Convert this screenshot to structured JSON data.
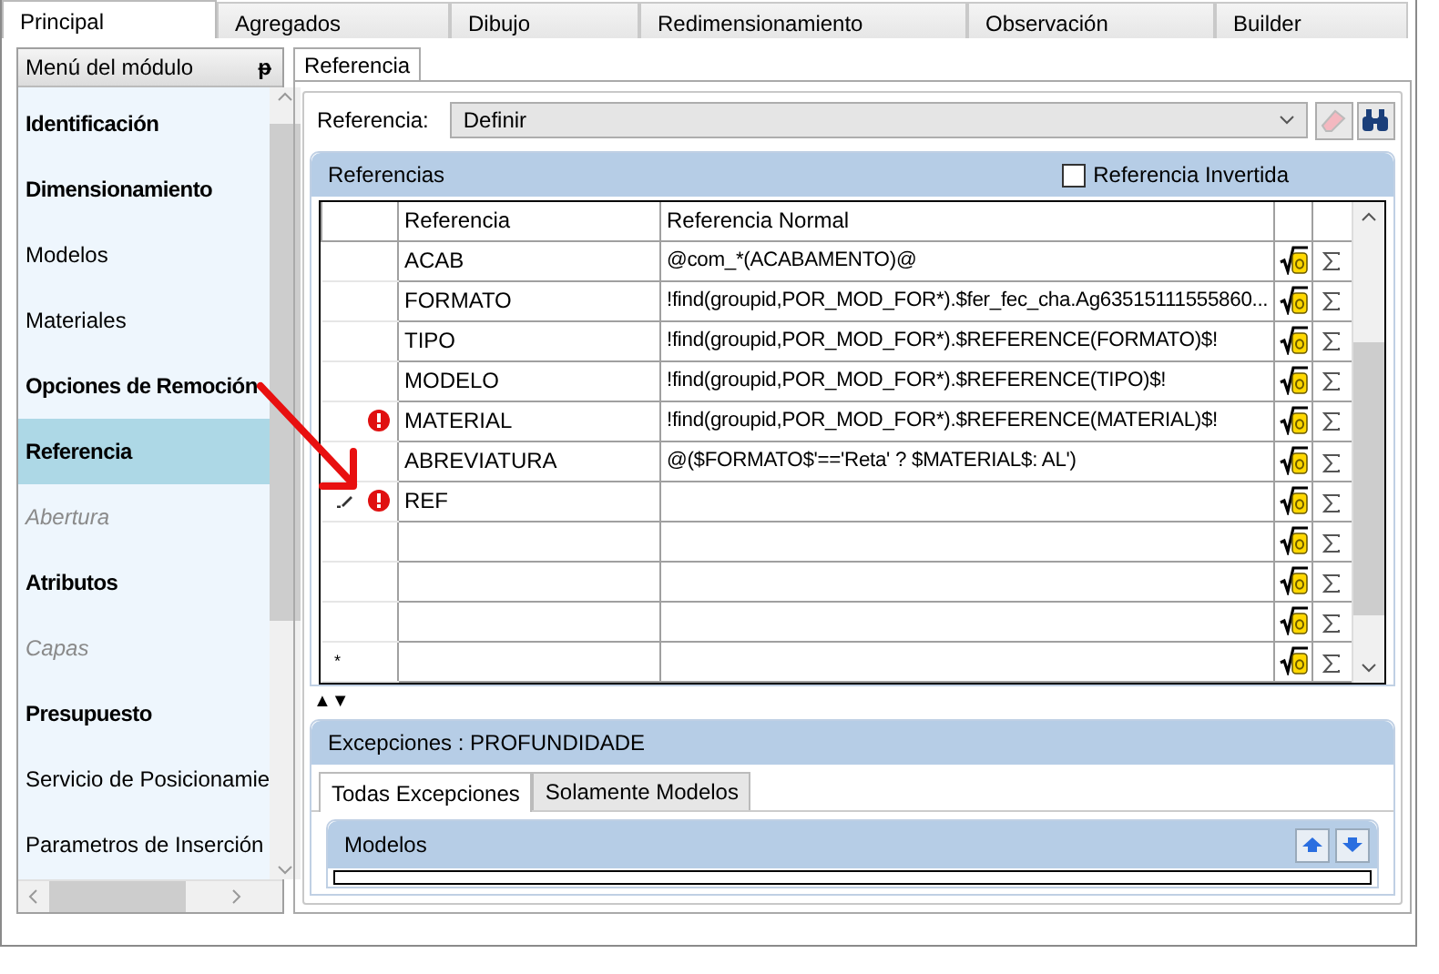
{
  "tabs": [
    {
      "label": "Principal",
      "selected": true
    },
    {
      "label": "Agregados",
      "selected": false
    },
    {
      "label": "Dibujo",
      "selected": false
    },
    {
      "label": "Redimensionamiento",
      "selected": false
    },
    {
      "label": "Observación",
      "selected": false
    },
    {
      "label": "Builder",
      "selected": false
    }
  ],
  "sidebar": {
    "title": "Menú del módulo",
    "pin": "ᵽ",
    "items": [
      {
        "label": "Identificación",
        "kind": "bold",
        "selected": false
      },
      {
        "label": "Dimensionamiento",
        "kind": "bold",
        "selected": false
      },
      {
        "label": "Modelos",
        "kind": "normal",
        "selected": false
      },
      {
        "label": "Materiales",
        "kind": "normal",
        "selected": false
      },
      {
        "label": "Opciones de Remoción",
        "kind": "bold",
        "selected": false
      },
      {
        "label": "Referencia",
        "kind": "bold",
        "selected": true
      },
      {
        "label": "Abertura",
        "kind": "disabled",
        "selected": false
      },
      {
        "label": "Atributos",
        "kind": "bold",
        "selected": false
      },
      {
        "label": "Capas",
        "kind": "disabled",
        "selected": false
      },
      {
        "label": "Presupuesto",
        "kind": "bold",
        "selected": false
      },
      {
        "label": "Servicio de Posicionamie",
        "kind": "normal",
        "selected": false
      },
      {
        "label": "Parametros de Inserción",
        "kind": "normal",
        "selected": false
      }
    ]
  },
  "content_tab": {
    "label": "Referencia",
    "selected": true
  },
  "reference_field": {
    "label": "Referencia:",
    "value": "Definir"
  },
  "references": {
    "title": "Referencias",
    "inverted": {
      "label": "Referencia Invertida",
      "checked": false
    },
    "columns": [
      "Referencia",
      "Referencia Normal"
    ],
    "rows": [
      {
        "reference": "ACAB",
        "normal": "@com_*(ACABAMENTO)@",
        "error": false,
        "editing": false
      },
      {
        "reference": "FORMATO",
        "normal": "!find(groupid,POR_MOD_FOR*).$fer_fec_cha.Ag63515111555860...",
        "error": false,
        "editing": false
      },
      {
        "reference": "TIPO",
        "normal": "!find(groupid,POR_MOD_FOR*).$REFERENCE(FORMATO)$!",
        "error": false,
        "editing": false
      },
      {
        "reference": "MODELO",
        "normal": "!find(groupid,POR_MOD_FOR*).$REFERENCE(TIPO)$!",
        "error": false,
        "editing": false
      },
      {
        "reference": "MATERIAL",
        "normal": "!find(groupid,POR_MOD_FOR*).$REFERENCE(MATERIAL)$!",
        "error": true,
        "editing": false
      },
      {
        "reference": "ABREVIATURA",
        "normal": "@($FORMATO$'=='Reta' ? $MATERIAL$: AL')",
        "error": false,
        "editing": false
      },
      {
        "reference": "REF",
        "error": true,
        "editing": true
      },
      {
        "error": false,
        "editing": false
      },
      {
        "error": false,
        "editing": false
      },
      {
        "error": false,
        "editing": false
      },
      {
        "marker": "*",
        "error": false,
        "editing": false
      }
    ]
  },
  "splitter": "▲▼",
  "exceptions": {
    "title": "Excepciones : PROFUNDIDADE",
    "tabs": [
      {
        "label": "Todas Excepciones",
        "selected": true
      },
      {
        "label": "Solamente Modelos",
        "selected": false
      }
    ],
    "models_title": "Modelos"
  }
}
